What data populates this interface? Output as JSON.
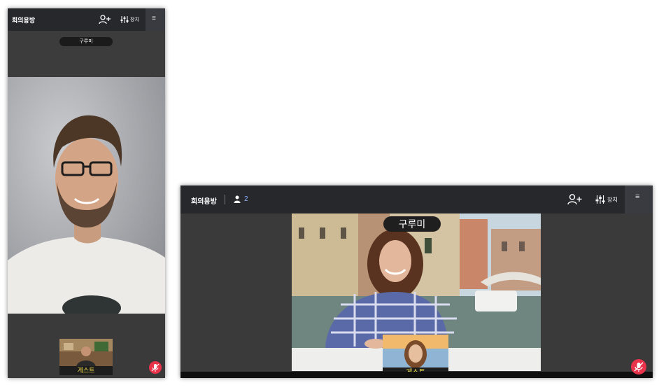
{
  "mobile": {
    "header": {
      "title": "회의용방",
      "devices_label": "장치"
    },
    "participant_name": "구루미",
    "self_view_label": "게스트"
  },
  "desktop": {
    "header": {
      "title": "회의용방",
      "participant_count": "2",
      "devices_label": "장치"
    },
    "participant_name": "구루미",
    "self_view_label": "게스트"
  },
  "colors": {
    "header_bg": "#26282c",
    "stage_bg": "#3a3a3a",
    "mic_button": "#e8334b",
    "self_label_text": "#f3e24a",
    "count_text": "#8fb1ff"
  },
  "icons": [
    "add-user-icon",
    "device-settings-icon",
    "menu-icon",
    "person-icon",
    "mic-muted-icon"
  ]
}
